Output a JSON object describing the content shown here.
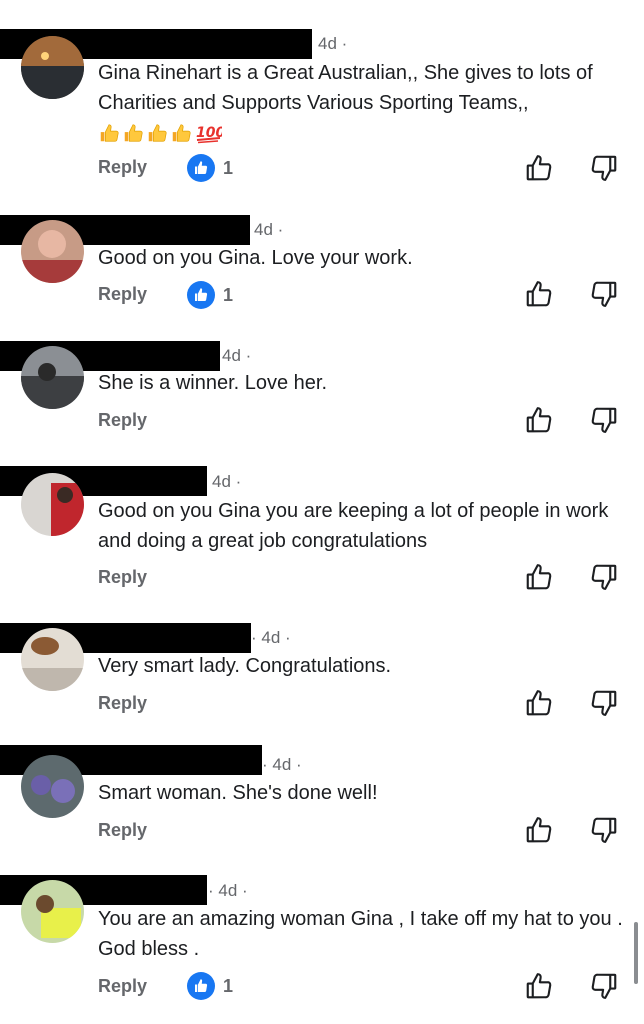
{
  "colors": {
    "brand_blue": "#1877f2",
    "meta_text": "#65676b",
    "body_text": "#1c1e21"
  },
  "icons": {
    "like_badge": "thumbs-up-badge-icon",
    "upvote": "thumbs-up-outline-icon",
    "downvote": "thumbs-down-outline-icon",
    "emoji": [
      "thumbs-up-emoji",
      "hundred-points-emoji"
    ]
  },
  "comments": [
    {
      "time": "4d ·",
      "text": "Gina Rinehart is a Great Australian,, She gives to lots of Charities and Supports Various Sporting Teams,,",
      "emoji_reaction": "👍👍👍👍💯",
      "reply_label": "Reply",
      "like_count": "1"
    },
    {
      "time": "4d ·",
      "text": "Good on you Gina. Love your work.",
      "reply_label": "Reply",
      "like_count": "1"
    },
    {
      "time": "4d ·",
      "text": "She is a winner. Love her.",
      "reply_label": "Reply"
    },
    {
      "time": "4d ·",
      "text": "Good on you Gina you are keeping a lot of people in work and doing a great job congratulations",
      "reply_label": "Reply"
    },
    {
      "time": "· 4d ·",
      "text": "Very smart lady. Congratulations.",
      "reply_label": "Reply"
    },
    {
      "time": "· 4d ·",
      "text": "Smart woman. She's done well!",
      "reply_label": "Reply"
    },
    {
      "time": "· 4d ·",
      "text": "You are an amazing woman Gina , I take off my hat to you . God bless .",
      "reply_label": "Reply",
      "like_count": "1"
    }
  ]
}
